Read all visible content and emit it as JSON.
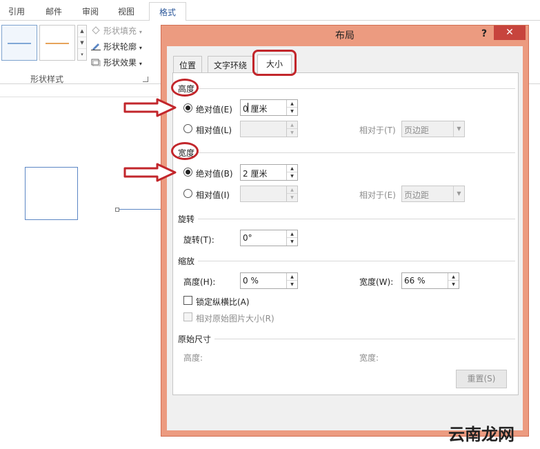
{
  "ribbon": {
    "tabs": [
      "引用",
      "邮件",
      "审阅",
      "视图",
      "格式"
    ],
    "shape_fill": "形状填充",
    "shape_outline": "形状轮廓",
    "shape_effects": "形状效果",
    "group_label": "形状样式",
    "swatch_colors": [
      "#7fa7d6",
      "#e6a35a"
    ]
  },
  "dialog": {
    "title": "布局",
    "help": "?",
    "close": "✕",
    "tabs": [
      "位置",
      "文字环绕",
      "大小"
    ],
    "active_tab": "大小",
    "height_section": {
      "label": "高度",
      "absolute_label": "绝对值(E)",
      "absolute_value": "0 厘米",
      "relative_label": "相对值(L)",
      "relative_to_label": "相对于(T)",
      "relative_to_value": "页边距"
    },
    "width_section": {
      "label": "宽度",
      "absolute_label": "绝对值(B)",
      "absolute_value": "2 厘米",
      "relative_label": "相对值(I)",
      "relative_to_label": "相对于(E)",
      "relative_to_value": "页边距"
    },
    "rotation_section": {
      "label": "旋转",
      "rotation_label": "旋转(T):",
      "rotation_value": "0°"
    },
    "scale_section": {
      "label": "缩放",
      "height_label": "高度(H):",
      "height_value": "0 %",
      "width_label": "宽度(W):",
      "width_value": "66 %",
      "lock_aspect_label": "锁定纵横比(A)",
      "relative_original_label": "相对原始图片大小(R)"
    },
    "original_size_section": {
      "label": "原始尺寸",
      "height_label": "高度:",
      "width_label": "宽度:"
    },
    "reset_button": "重置(S)"
  },
  "watermark": "云南龙网",
  "annotation_color": "#c2262b"
}
